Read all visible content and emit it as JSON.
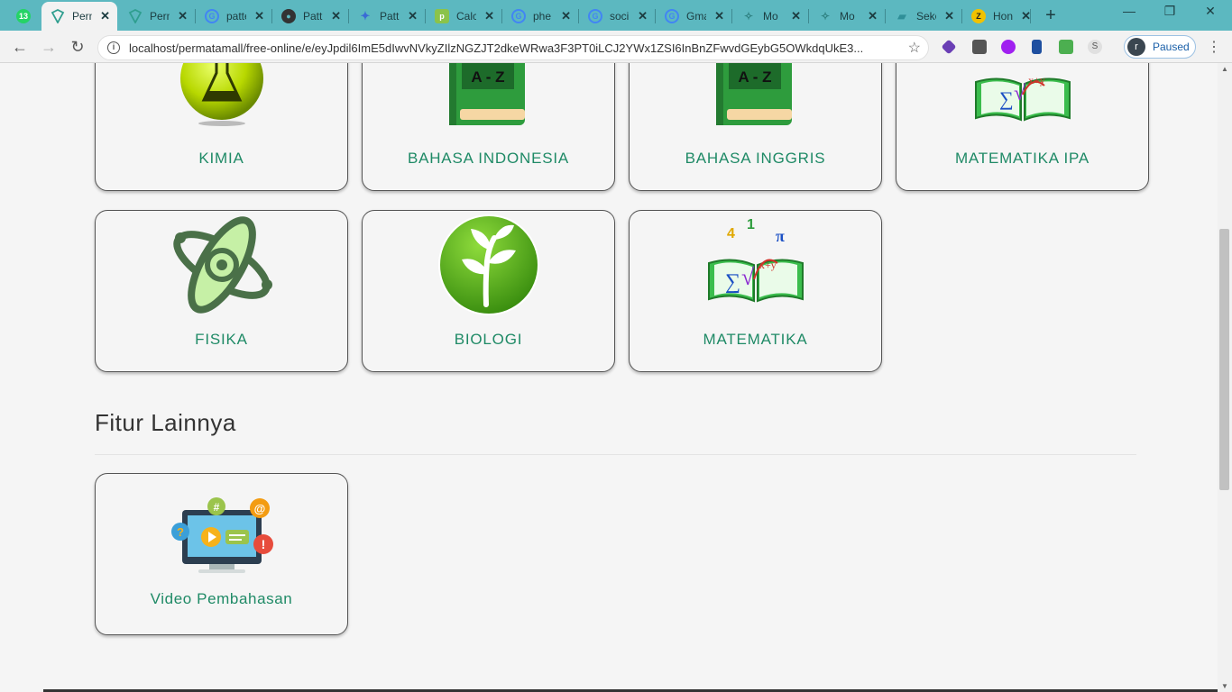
{
  "browser": {
    "tabs": [
      {
        "title": "",
        "badge": "13",
        "icon": "whatsapp-icon",
        "color": "#25d366"
      },
      {
        "title": "Perm",
        "icon": "permata-icon",
        "color": "#2f9e8f",
        "active": true
      },
      {
        "title": "Perm",
        "icon": "permata-icon",
        "color": "#2f9e8f"
      },
      {
        "title": "patte",
        "icon": "google-icon",
        "color": "#4285f4"
      },
      {
        "title": "Patt",
        "icon": "globe-icon",
        "color": "#333333"
      },
      {
        "title": "Patt",
        "icon": "puzzle-icon",
        "color": "#3a6ad6"
      },
      {
        "title": "Calc",
        "icon": "p-icon",
        "color": "#8bc34a"
      },
      {
        "title": "phe",
        "icon": "google-icon",
        "color": "#4285f4"
      },
      {
        "title": "soci",
        "icon": "google-icon",
        "color": "#4285f4"
      },
      {
        "title": "Gma",
        "icon": "google-icon",
        "color": "#4285f4"
      },
      {
        "title": "Mo",
        "icon": "sparkle-icon",
        "color": "#5aa0a0"
      },
      {
        "title": "Mo",
        "icon": "sparkle-icon",
        "color": "#5aa0a0"
      },
      {
        "title": "Seko",
        "icon": "book-icon",
        "color": "#4fb0b8"
      },
      {
        "title": "Hon",
        "icon": "z-icon",
        "color": "#f2c200"
      }
    ],
    "new_tab": "+",
    "window_controls": {
      "minimize": "—",
      "restore": "❐",
      "close": "✕"
    },
    "nav": {
      "back": "←",
      "forward": "→",
      "reload": "↻"
    },
    "url": "localhost/permatamall/free-online/e/eyJpdil6ImE5dIwvNVkyZIlzNGZJT2dkeWRwa3F3PT0iLCJ2YWx1ZSI6InBnZFwvdGEybG5OWkdqUkE3...",
    "star": "☆",
    "extensions": [
      {
        "name": "cube-extension-icon",
        "color": "#6a3fb5"
      },
      {
        "name": "terminal-extension-icon",
        "color": "#555555"
      },
      {
        "name": "circle-extension-icon",
        "color": "#a020f0"
      },
      {
        "name": "bookmark-extension-icon",
        "color": "#1e4fa0"
      },
      {
        "name": "image-extension-icon",
        "color": "#4caf50"
      },
      {
        "name": "s-extension-icon",
        "color": "#9e9e9e"
      }
    ],
    "profile": {
      "initial": "r",
      "status": "Paused"
    },
    "menu": "⋮"
  },
  "subjects": [
    {
      "label": "KIMIA",
      "icon": "chemistry-flask-icon"
    },
    {
      "label": "BAHASA INDONESIA",
      "icon": "dictionary-book-icon"
    },
    {
      "label": "BAHASA INGGRIS",
      "icon": "dictionary-book-icon"
    },
    {
      "label": "MATEMATIKA IPA",
      "icon": "math-book-icon"
    },
    {
      "label": "FISIKA",
      "icon": "atom-icon"
    },
    {
      "label": "BIOLOGI",
      "icon": "plant-icon"
    },
    {
      "label": "MATEMATIKA",
      "icon": "math-book-icon"
    }
  ],
  "book_text": "A - Z",
  "more_features": {
    "title": "Fitur Lainnya",
    "items": [
      {
        "label": "Video Pembahasan",
        "icon": "video-lesson-icon"
      }
    ]
  },
  "colors": {
    "accent": "#1f8a66",
    "tab_strip": "#5cb8c0",
    "background": "#f5f5f5"
  }
}
